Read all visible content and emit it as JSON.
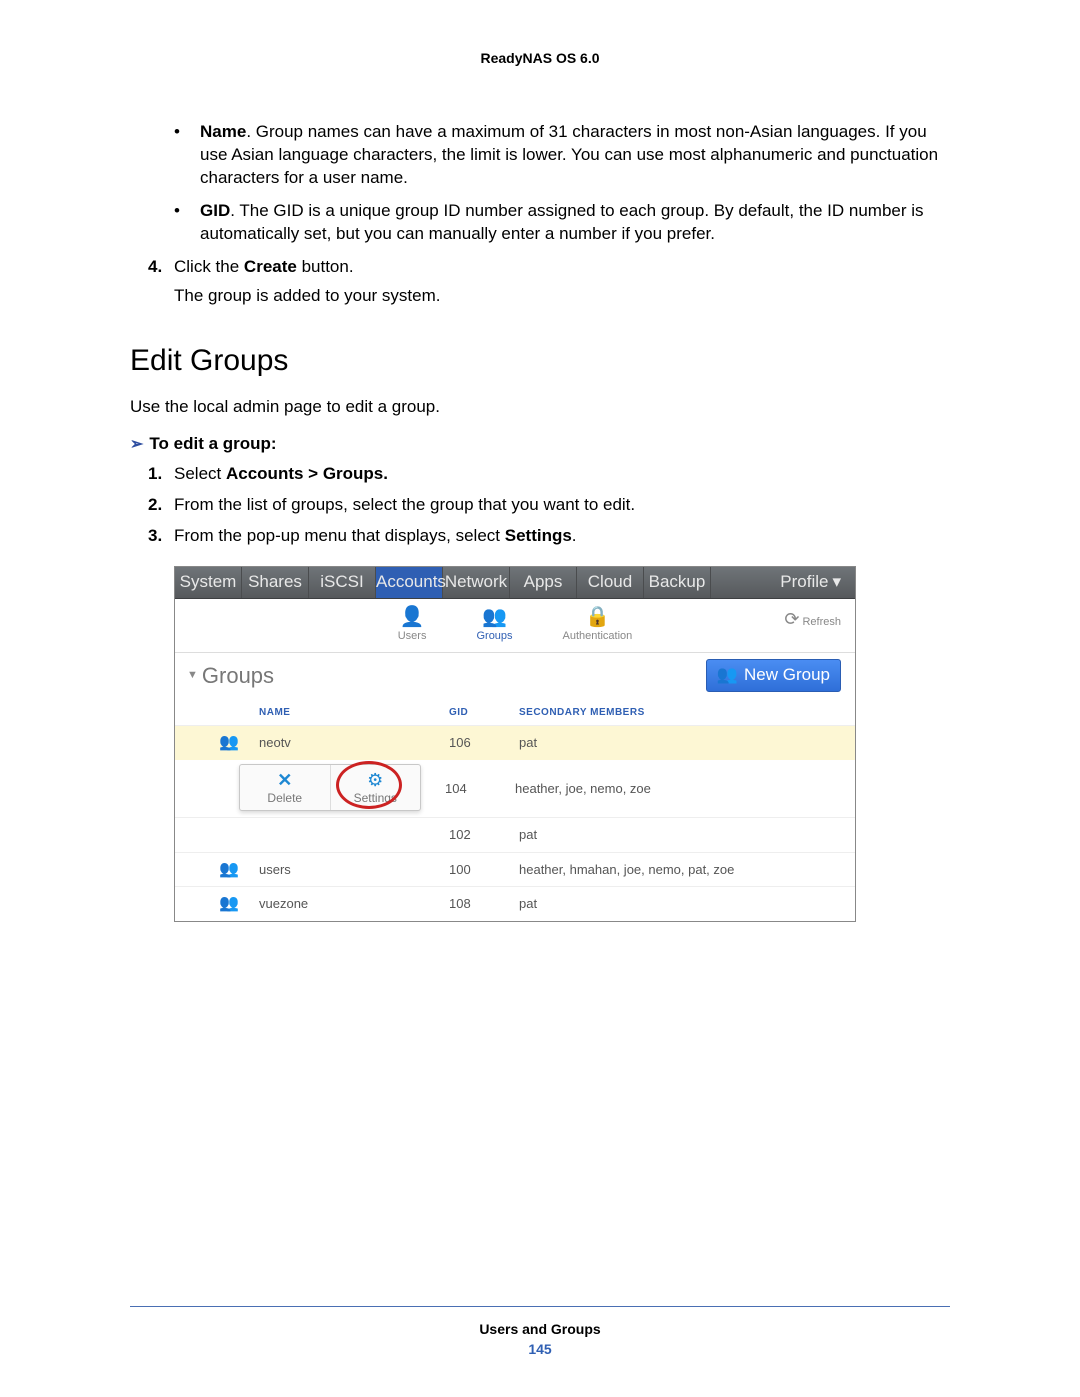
{
  "header": {
    "product": "ReadyNAS OS 6.0"
  },
  "body": {
    "name_item": {
      "lead": "Name",
      "text": ". Group names can have a maximum of 31 characters in most non-Asian languages. If you use Asian language characters, the limit is lower. You can use most alphanumeric and punctuation characters for a user name."
    },
    "gid_item": {
      "lead": "GID",
      "text": ". The GID is a unique group ID number assigned to each group. By default, the ID number is automatically set, but you can manually enter a number if you prefer."
    },
    "step4": {
      "num": "4.",
      "pre": "Click the ",
      "bold": "Create",
      "post": " button."
    },
    "step4_result": "The group is added to your system.",
    "section": "Edit Groups",
    "intro": "Use the local admin page to edit a group.",
    "proc_title": "To edit a group:",
    "steps": [
      {
        "num": "1.",
        "pre": "Select ",
        "bold": "Accounts > Groups.",
        "post": ""
      },
      {
        "num": "2.",
        "pre": "From the list of groups, select the group that you want to edit.",
        "bold": "",
        "post": ""
      },
      {
        "num": "3.",
        "pre": "From the pop-up menu that displays, select ",
        "bold": "Settings",
        "post": "."
      }
    ]
  },
  "ui": {
    "topnav": {
      "tabs": [
        "System",
        "Shares",
        "iSCSI",
        "Accounts",
        "Network",
        "Apps",
        "Cloud",
        "Backup"
      ],
      "active": "Accounts",
      "profile": "Profile"
    },
    "toolbar": {
      "items": [
        {
          "label": "Users",
          "icon": "👤"
        },
        {
          "label": "Groups",
          "icon": "👥"
        },
        {
          "label": "Authentication",
          "icon": "🔒"
        }
      ],
      "active": "Groups",
      "refresh": "Refresh"
    },
    "groups_title": "Groups",
    "btn_new": "New Group",
    "columns": {
      "name": "Name",
      "gid": "GID",
      "members": "Secondary Members"
    },
    "rows": [
      {
        "name": "neotv",
        "gid": "106",
        "members": "pat",
        "hl": true
      },
      {
        "name": "",
        "gid": "104",
        "members": "heather, joe, nemo, zoe"
      },
      {
        "name": "",
        "gid": "102",
        "members": "pat"
      },
      {
        "name": "users",
        "gid": "100",
        "members": "heather, hmahan, joe, nemo, pat, zoe"
      },
      {
        "name": "vuezone",
        "gid": "108",
        "members": "pat"
      }
    ],
    "popup": {
      "delete": "Delete",
      "settings": "Settings"
    }
  },
  "footer": {
    "section": "Users and Groups",
    "page": "145"
  }
}
